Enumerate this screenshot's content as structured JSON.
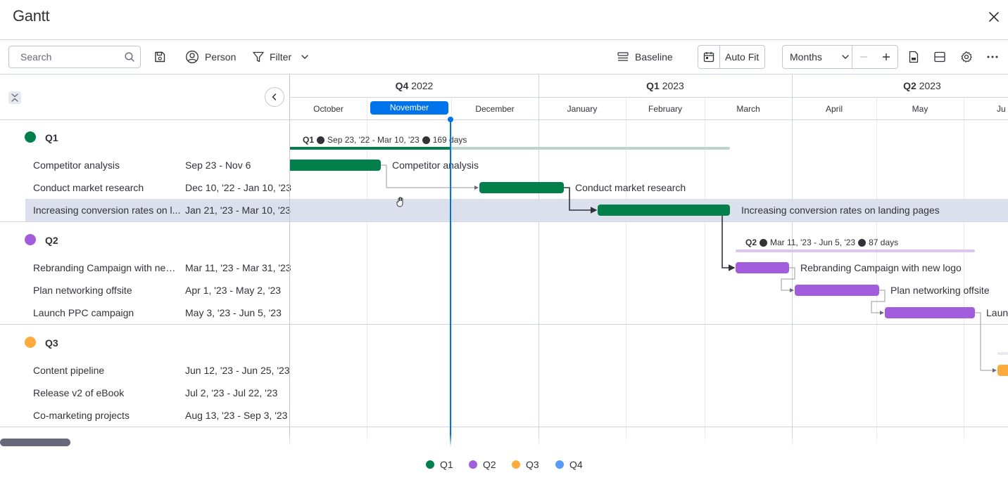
{
  "header": {
    "title": "Gantt"
  },
  "toolbar": {
    "search_placeholder": "Search",
    "person_label": "Person",
    "filter_label": "Filter",
    "baseline_label": "Baseline",
    "autofit_label": "Auto Fit",
    "scale_value": "Months"
  },
  "timeline": {
    "quarters": [
      {
        "bold": "Q4",
        "year": "2022"
      },
      {
        "bold": "Q1",
        "year": "2023"
      },
      {
        "bold": "Q2",
        "year": "2023"
      }
    ],
    "months": [
      "October",
      "November",
      "December",
      "January",
      "February",
      "March",
      "April",
      "May",
      "Ju"
    ],
    "selected_month": "November"
  },
  "groups": [
    {
      "name": "Q1",
      "color": "#037f4c",
      "summary": {
        "name": "Q1",
        "range": "Sep 23, '22 - Mar 10, '23",
        "days": "169 days"
      },
      "rows": [
        {
          "name": "Competitor analysis",
          "date": "Sep 23 - Nov 6",
          "bar_label": "Competitor analysis"
        },
        {
          "name": "Conduct market research",
          "date": "Dec 10, '22 - Jan 10, '23",
          "bar_label": "Conduct market research"
        },
        {
          "name": "Increasing conversion rates on l...",
          "date": "Jan 21, '23 - Mar 10, '23",
          "bar_label": "Increasing conversion rates on landing pages"
        }
      ]
    },
    {
      "name": "Q2",
      "color": "#a25ddc",
      "summary": {
        "name": "Q2",
        "range": "Mar 11, '23 - Jun 5, '23",
        "days": "87 days"
      },
      "rows": [
        {
          "name": "Rebranding Campaign with new ...",
          "date": "Mar 11, '23 - Mar 31, '23",
          "bar_label": "Rebranding Campaign with new logo"
        },
        {
          "name": "Plan networking offsite",
          "date": "Apr 1, '23 - May 2, '23",
          "bar_label": "Plan networking offsite"
        },
        {
          "name": "Launch PPC campaign",
          "date": "May 3, '23 - Jun 5, '23",
          "bar_label": "Laun"
        }
      ]
    },
    {
      "name": "Q3",
      "color": "#fdab3d",
      "rows": [
        {
          "name": "Content pipeline",
          "date": "Jun 12, '23 - Jun 25, '23"
        },
        {
          "name": "Release v2 of eBook",
          "date": "Jul 2, '23 - Jul 22, '23"
        },
        {
          "name": "Co-marketing projects",
          "date": "Aug 13, '23 - Sep 3, '23"
        }
      ]
    }
  ],
  "legend": [
    {
      "label": "Q1",
      "color": "#037f4c"
    },
    {
      "label": "Q2",
      "color": "#a25ddc"
    },
    {
      "label": "Q3",
      "color": "#fdab3d"
    },
    {
      "label": "Q4",
      "color": "#579bfc"
    }
  ],
  "icons": [
    "close-icon",
    "search-icon",
    "save-icon",
    "person-icon",
    "filter-icon",
    "chevron-down-icon",
    "baseline-icon",
    "calendar-icon",
    "minus-icon",
    "plus-icon",
    "export-icon",
    "layout-icon",
    "gear-icon",
    "more-icon",
    "collapse-icon",
    "chevron-left-icon",
    "hand-cursor-icon"
  ]
}
